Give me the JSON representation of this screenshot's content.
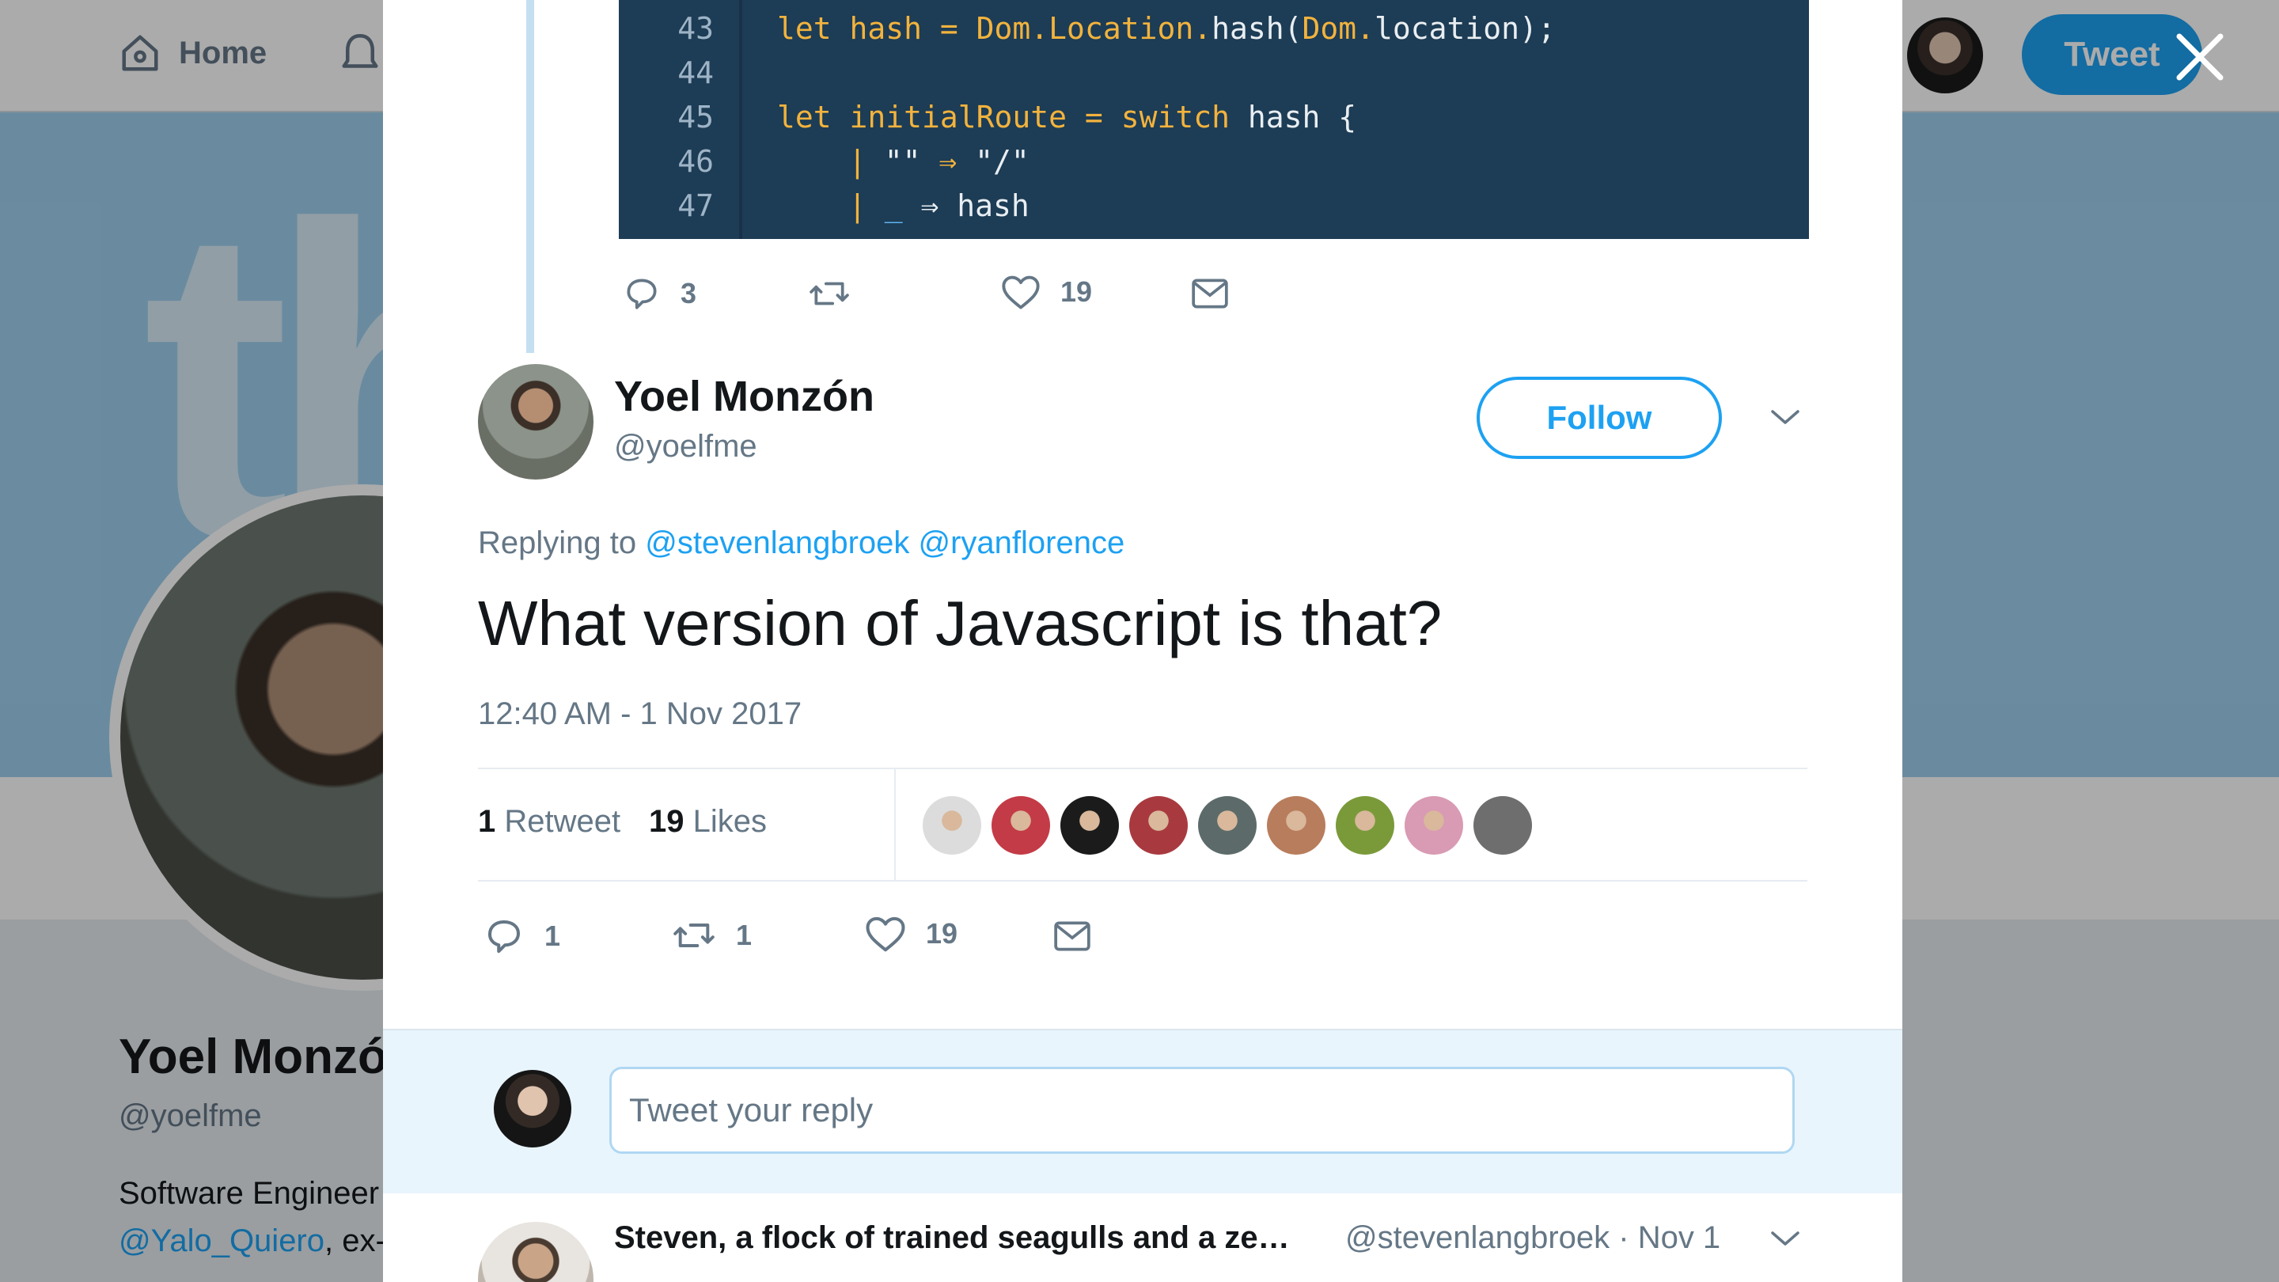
{
  "background": {
    "nav_home_label": "Home",
    "tweet_button_label": "Tweet",
    "banner_text": "th",
    "profile_name": "Yoel Monzó",
    "profile_handle": "@yoelfme",
    "bio_line1": "Software Engineer",
    "bio_line2_link": "@Yalo_Quiero",
    "bio_line2_rest": ", ex-"
  },
  "previous_tweet": {
    "code_lines": [
      {
        "n": "43"
      },
      {
        "n": "44"
      },
      {
        "n": "45"
      },
      {
        "n": "46"
      },
      {
        "n": "47"
      }
    ],
    "code": {
      "l43_kw": "let",
      "l43_var": " hash = ",
      "l43_type": "Dom.Location.",
      "l43_fn": "hash(",
      "l43_arg": "Dom.",
      "l43_end": "location);",
      "l45_kw": "let",
      "l45_var": " initialRoute = ",
      "l45_switch": "switch",
      "l45_end": " hash {",
      "l46_bar": "|",
      "l46_pat": " \"\" ",
      "l46_arrow": "⇒",
      "l46_val": " \"/\"",
      "l47_bar": "|",
      "l47_pat": " _ ",
      "l47_arrow": "⇒",
      "l47_val": " hash"
    },
    "reply_count": "3",
    "retweet_count": "",
    "like_count": "19"
  },
  "tweet": {
    "author_name": "Yoel Monzón",
    "author_handle": "@yoelfme",
    "follow_label": "Follow",
    "replying_prefix": "Replying to ",
    "replying_to": [
      "@stevenlangbroek",
      "@ryanflorence"
    ],
    "text": "What version of Javascript is that?",
    "timestamp": "12:40 AM - 1 Nov 2017",
    "retweets_count": "1",
    "retweets_label": "Retweet",
    "likes_count": "19",
    "likes_label": "Likes",
    "liker_colors": [
      "#dcdcdc",
      "#c33b46",
      "#1b1b1b",
      "#a83a3f",
      "#5c6b6a",
      "#b87d5c",
      "#7a9a3a",
      "#d99ab3",
      "#6e6e6e"
    ],
    "reply_count": "1",
    "retweet_count": "1",
    "like_count": "19"
  },
  "reply_box": {
    "placeholder": "Tweet your reply"
  },
  "next_tweet": {
    "name": "Steven, a flock of trained seagulls and a ze…",
    "handle": "@stevenlangbroek",
    "date": "Nov 1"
  },
  "colors": {
    "accent": "#1da1f2",
    "code_bg": "#1d3c55",
    "text_secondary": "#657786"
  }
}
